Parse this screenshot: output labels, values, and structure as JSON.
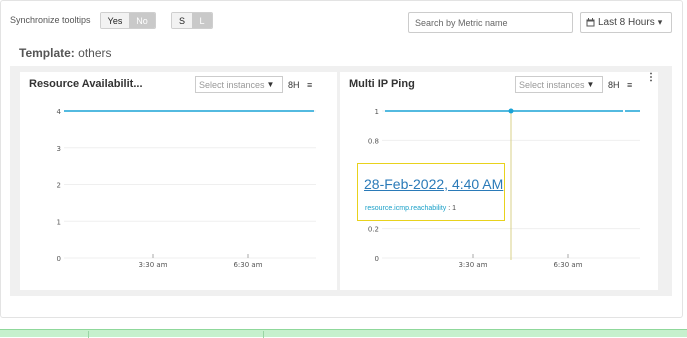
{
  "toolbar": {
    "sync_label": "Synchronize tooltips",
    "sync_yes": "Yes",
    "sync_no": "No",
    "size_s": "S",
    "size_l": "L",
    "search_placeholder": "Search by Metric name",
    "time_range": "Last 8 Hours",
    "time_caret": "▾"
  },
  "template": {
    "label": "Template:",
    "name": "others"
  },
  "panels": [
    {
      "title": "Resource Availabilit...",
      "instances_placeholder": "Select instances",
      "range": "8H",
      "chart_data": {
        "type": "line",
        "x_ticks": [
          "3:30 am",
          "6:30 am"
        ],
        "y_ticks": [
          "0",
          "1",
          "2",
          "3",
          "4"
        ],
        "ylim": [
          0,
          4
        ],
        "series": [
          {
            "values": [
              4,
              4
            ]
          }
        ]
      }
    },
    {
      "title": "Multi IP Ping",
      "instances_placeholder": "Select instances",
      "range": "8H",
      "chart_data": {
        "type": "line",
        "x_ticks": [
          "3:30 am",
          "6:30 am"
        ],
        "y_ticks": [
          "0",
          "0.2",
          "0.8",
          "1"
        ],
        "ylim": [
          0,
          1
        ],
        "series": [
          {
            "values": [
              1,
              1
            ]
          }
        ]
      },
      "tooltip": {
        "date": "28-Feb-2022, 4:40 AM",
        "metric": "resource.icmp.reachability",
        "value": " : 1"
      }
    }
  ],
  "colors": {
    "series": "#1aa3d6",
    "tooltip_border": "#e8d21d",
    "crosshair": "#d8d08a",
    "bottom_bar": "#c6f0cd"
  }
}
